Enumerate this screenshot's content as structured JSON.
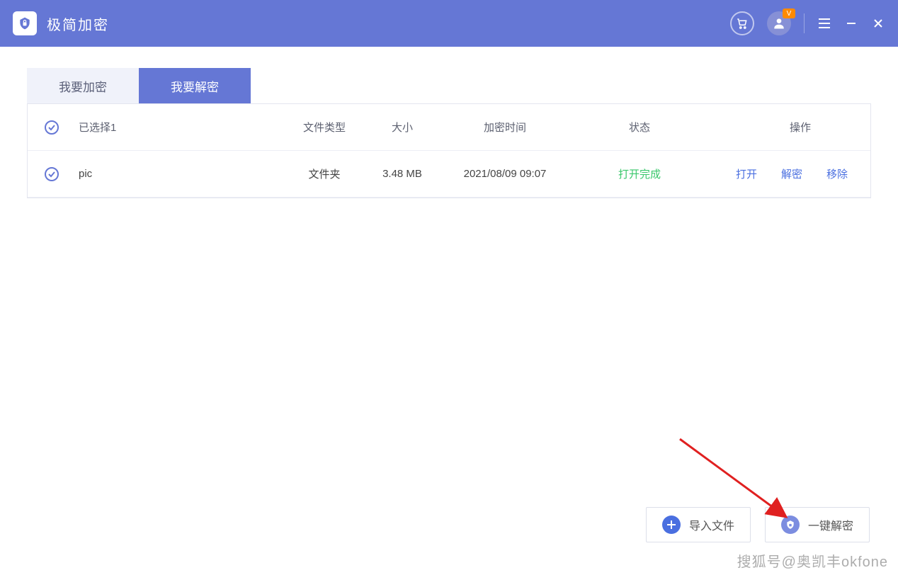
{
  "app": {
    "title": "极简加密"
  },
  "tabs": {
    "encrypt": "我要加密",
    "decrypt": "我要解密"
  },
  "table": {
    "selected_label": "已选择1",
    "headers": {
      "type": "文件类型",
      "size": "大小",
      "time": "加密时间",
      "status": "状态",
      "actions": "操作"
    },
    "rows": [
      {
        "name": "pic",
        "type": "文件夹",
        "size": "3.48 MB",
        "time": "2021/08/09 09:07",
        "status": "打开完成",
        "open": "打开",
        "decrypt": "解密",
        "remove": "移除"
      }
    ]
  },
  "buttons": {
    "import": "导入文件",
    "decrypt_all": "一键解密"
  },
  "watermark": "搜狐号@奥凯丰okfone"
}
